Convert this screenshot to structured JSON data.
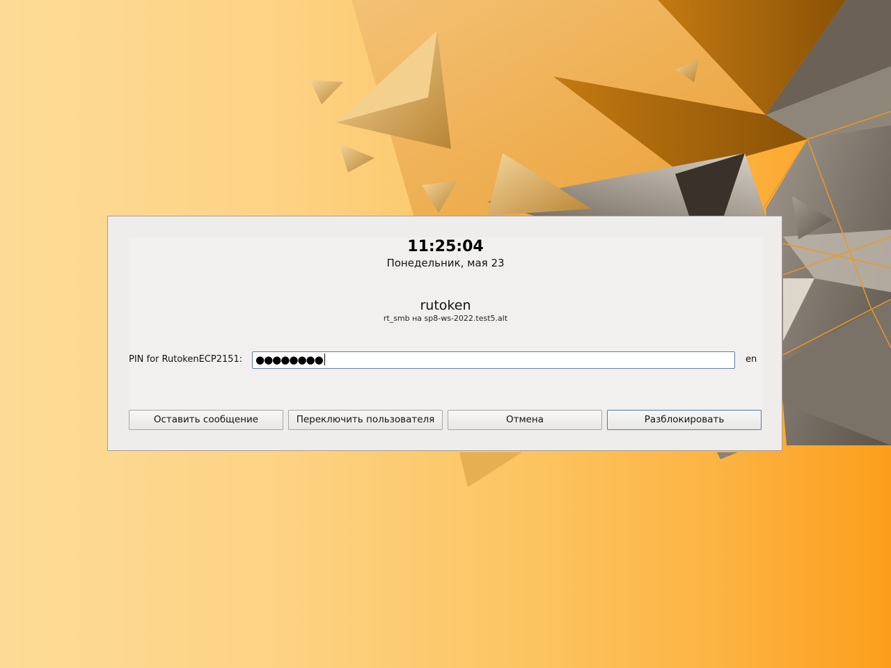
{
  "lock_dialog": {
    "clock": "11:25:04",
    "date": "Понедельник, мая 23",
    "username": "rutoken",
    "user_host": "rt_smb на sp8-ws-2022.test5.alt",
    "pin_label": "PIN for RutokenECP2151:",
    "pin_value": "●●●●●●●●",
    "keyboard_layout": "en",
    "buttons": {
      "leave_message": "Оставить сообщение",
      "switch_user": "Переключить пользователя",
      "cancel": "Отмена",
      "unlock": "Разблокировать"
    }
  },
  "colors": {
    "dialog_background": "#eeedec",
    "default_button_border": "#4f77a6",
    "wallpaper_orange": "#fc9e1c"
  }
}
